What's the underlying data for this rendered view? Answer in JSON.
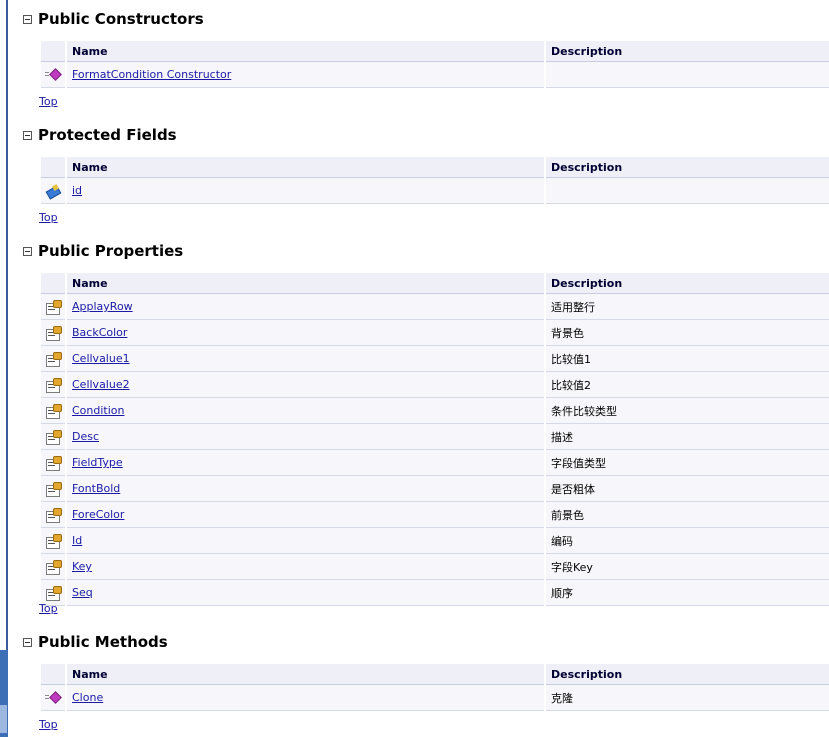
{
  "sections": [
    {
      "title": "Public Constructors",
      "headers": {
        "name": "Name",
        "description": "Description"
      },
      "rows": [
        {
          "icon": "method-icon",
          "name": "FormatCondition Constructor",
          "description": ""
        }
      ],
      "top_link": "Top"
    },
    {
      "title": "Protected Fields",
      "headers": {
        "name": "Name",
        "description": "Description"
      },
      "rows": [
        {
          "icon": "field-icon",
          "name": "id",
          "description": ""
        }
      ],
      "top_link": "Top"
    },
    {
      "title": "Public Properties",
      "headers": {
        "name": "Name",
        "description": "Description"
      },
      "rows": [
        {
          "icon": "property-icon",
          "name": "ApplayRow",
          "description": "适用整行"
        },
        {
          "icon": "property-icon",
          "name": "BackColor",
          "description": "背景色"
        },
        {
          "icon": "property-icon",
          "name": "Cellvalue1",
          "description": "比较值1"
        },
        {
          "icon": "property-icon",
          "name": "Cellvalue2",
          "description": "比较值2"
        },
        {
          "icon": "property-icon",
          "name": "Condition",
          "description": "条件比较类型"
        },
        {
          "icon": "property-icon",
          "name": "Desc",
          "description": "描述"
        },
        {
          "icon": "property-icon",
          "name": "FieldType",
          "description": "字段值类型"
        },
        {
          "icon": "property-icon",
          "name": "FontBold",
          "description": "是否粗体"
        },
        {
          "icon": "property-icon",
          "name": "ForeColor",
          "description": "前景色"
        },
        {
          "icon": "property-icon",
          "name": "Id",
          "description": "编码"
        },
        {
          "icon": "property-icon",
          "name": "Key",
          "description": "字段Key"
        },
        {
          "icon": "property-icon",
          "name": "Seq",
          "description": "顺序"
        }
      ],
      "top_link": "Top"
    },
    {
      "title": "Public Methods",
      "headers": {
        "name": "Name",
        "description": "Description"
      },
      "rows": [
        {
          "icon": "method-icon",
          "name": "Clone",
          "description": "克隆"
        }
      ],
      "top_link": "Top"
    }
  ]
}
